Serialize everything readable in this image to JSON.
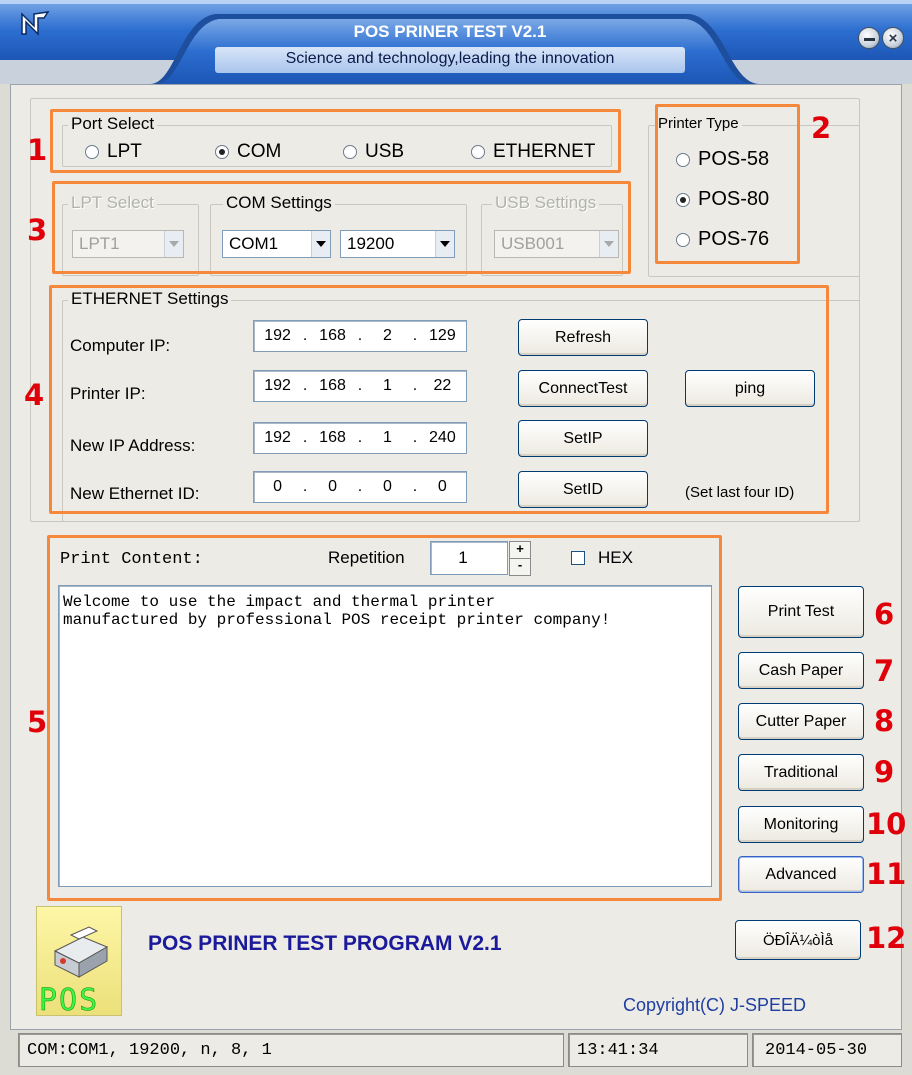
{
  "window": {
    "title": "POS PRINER TEST V2.1",
    "subtitle": "Science and technology,leading the innovation",
    "logo_icon": "app-logo-icon",
    "minimize_icon": "minimize-icon",
    "close_icon": "close-icon"
  },
  "port_select": {
    "legend": "Port Select",
    "options": [
      {
        "label": "LPT",
        "selected": false
      },
      {
        "label": "COM",
        "selected": true
      },
      {
        "label": "USB",
        "selected": false
      },
      {
        "label": "ETHERNET",
        "selected": false
      }
    ]
  },
  "printer_type": {
    "legend": "Printer Type",
    "options": [
      {
        "label": "POS-58",
        "selected": false
      },
      {
        "label": "POS-80",
        "selected": true
      },
      {
        "label": "POS-76",
        "selected": false
      }
    ]
  },
  "lpt_select": {
    "legend": "LPT Select",
    "value": "LPT1",
    "enabled": false
  },
  "com_settings": {
    "legend": "COM Settings",
    "port": "COM1",
    "baud": "19200"
  },
  "usb_settings": {
    "legend": "USB Settings",
    "value": "USB001",
    "enabled": false
  },
  "ethernet": {
    "legend": "ETHERNET Settings",
    "rows": [
      {
        "label": "Computer IP:",
        "ip": [
          "192",
          "168",
          "2",
          "129"
        ],
        "button": "Refresh"
      },
      {
        "label": "Printer IP:",
        "ip": [
          "192",
          "168",
          "1",
          "22"
        ],
        "button": "ConnectTest"
      },
      {
        "label": "New IP Address:",
        "ip": [
          "192",
          "168",
          "1",
          "240"
        ],
        "button": "SetIP"
      },
      {
        "label": "New Ethernet ID:",
        "ip": [
          "0",
          "0",
          "0",
          "0"
        ],
        "button": "SetID"
      }
    ],
    "ping_button": "ping",
    "hint": "(Set last four ID)"
  },
  "print": {
    "label": "Print Content:",
    "repetition_label": "Repetition",
    "repetition_value": "1",
    "hex_label": "HEX",
    "hex_checked": false,
    "content": "Welcome to use the impact and thermal printer\nmanufactured by professional POS receipt printer company!"
  },
  "buttons": {
    "print_test": "Print Test",
    "cash_paper": "Cash Paper",
    "cutter_paper": "Cutter Paper",
    "traditional": "Traditional",
    "monitoring": "Monitoring",
    "advanced": "Advanced",
    "language": "ÖÐÎÄ¼òÌå"
  },
  "footer": {
    "program_title": "POS PRINER TEST PROGRAM V2.1",
    "copyright": "Copyright(C) J-SPEED",
    "logo_text": "POS"
  },
  "status": {
    "port": "COM:COM1, 19200, n, 8, 1",
    "time": "13:41:34",
    "date": "2014-05-30"
  },
  "annotations": [
    "1",
    "2",
    "3",
    "4",
    "5",
    "6",
    "7",
    "8",
    "9",
    "10",
    "11",
    "12"
  ],
  "colors": {
    "annotation_box": "#f5883a",
    "annotation_number": "#e0000a",
    "title_text": "#ffffff",
    "program_title": "#1a1a9a",
    "copyright": "#1f3fa0"
  }
}
